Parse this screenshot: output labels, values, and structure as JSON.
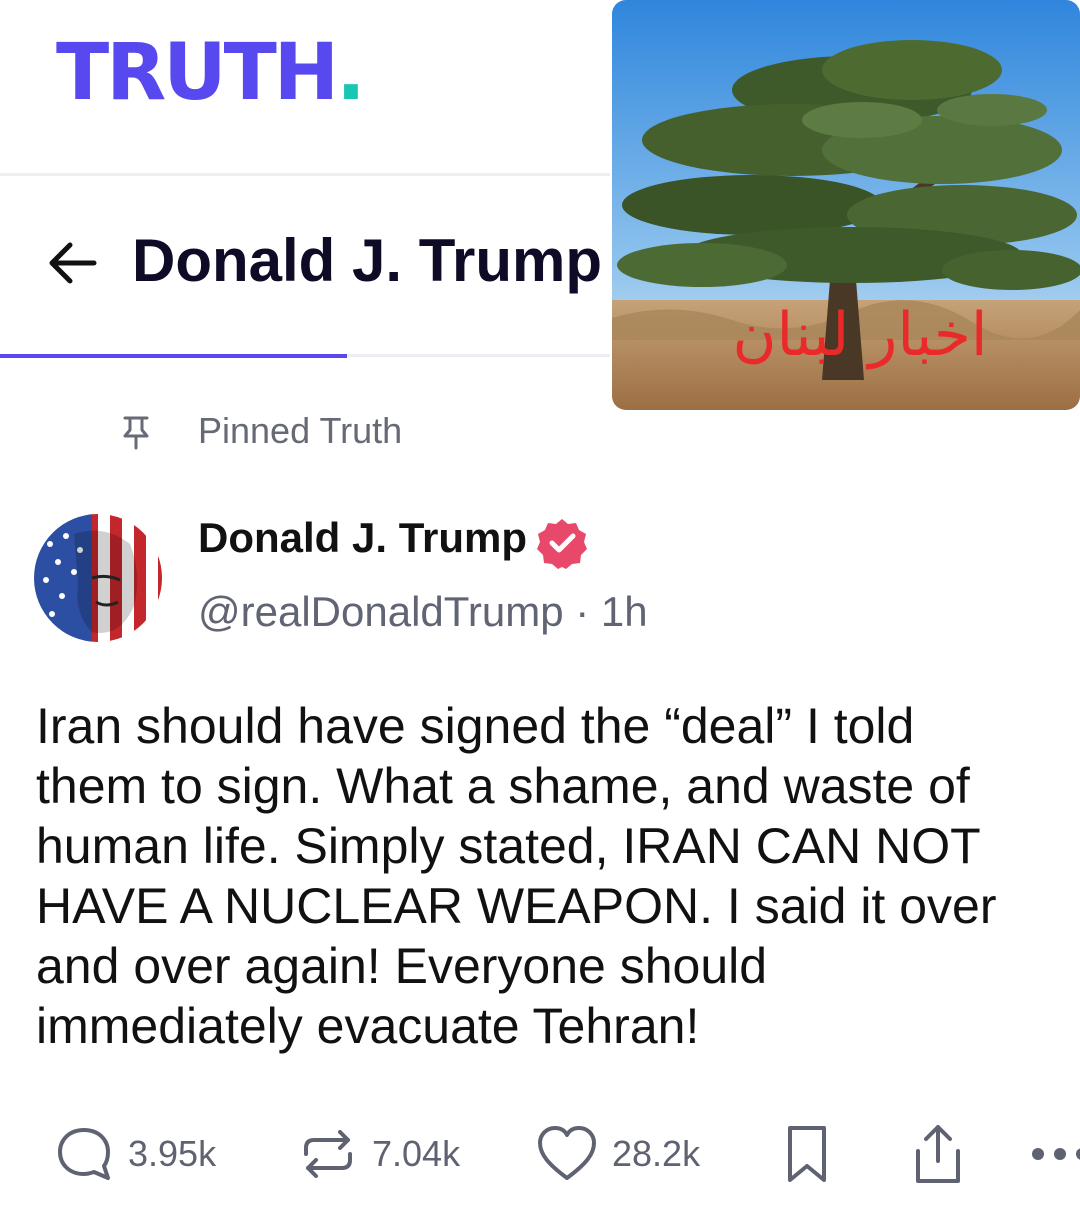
{
  "header": {
    "logo_text": "TRUTH",
    "logo_dot": ".",
    "profile_title": "Donald J. Trump",
    "brand_color": "#5848f0",
    "brand_accent": "#18c7b2"
  },
  "overlay": {
    "caption": "اخبار لبنان",
    "caption_color": "#ea2a2a",
    "image": "cedar-tree-photo"
  },
  "pinned": {
    "label": "Pinned Truth"
  },
  "post": {
    "author_name": "Donald J. Trump",
    "handle": "@realDonaldTrump",
    "separator": "·",
    "time": "1h",
    "text": "Iran should have signed the “deal” I told them to sign. What a shame, and waste of human life. Simply stated, IRAN CAN NOT HAVE A NUCLEAR WEAPON. I said it over and over again! Everyone should immediately evacuate Tehran!",
    "verified_color": "#e8496a"
  },
  "actions": {
    "replies": "3.95k",
    "retruths": "7.04k",
    "likes": "28.2k"
  }
}
